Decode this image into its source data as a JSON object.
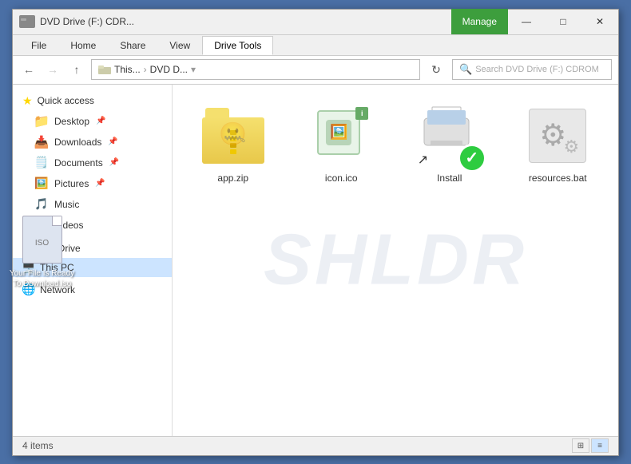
{
  "window": {
    "title": "DVD Drive (F:) CDR...",
    "manage_label": "Manage"
  },
  "title_bar": {
    "icon_label": "📁",
    "title": "DVD Drive (F:) CDR...",
    "min": "—",
    "max": "□",
    "close": "✕"
  },
  "ribbon": {
    "tabs": [
      "File",
      "Home",
      "Share",
      "View",
      "Drive Tools"
    ],
    "active_tab": "Drive Tools"
  },
  "address_bar": {
    "back": "←",
    "forward": "→",
    "up": "↑",
    "breadcrumb_1": "This...",
    "breadcrumb_2": "DVD D...",
    "refresh": "↻",
    "search_placeholder": "Search DVD Drive (F:) CDROM"
  },
  "sidebar": {
    "quick_access": {
      "label": "Quick access",
      "items": [
        {
          "label": "Desktop",
          "pinned": true
        },
        {
          "label": "Downloads",
          "pinned": true
        },
        {
          "label": "Documents",
          "pinned": true
        },
        {
          "label": "Pictures",
          "pinned": true
        },
        {
          "label": "Music",
          "pinned": false
        },
        {
          "label": "Videos",
          "pinned": false
        }
      ]
    },
    "onedrive": {
      "label": "OneDrive"
    },
    "this_pc": {
      "label": "This PC"
    },
    "network": {
      "label": "Network"
    }
  },
  "content": {
    "watermark": "SHLDR",
    "files": [
      {
        "name": "app.zip",
        "type": "zip"
      },
      {
        "name": "icon.ico",
        "type": "ico"
      },
      {
        "name": "Install",
        "type": "installer"
      },
      {
        "name": "resources.bat",
        "type": "bat"
      }
    ]
  },
  "status_bar": {
    "item_count": "4 items",
    "view1": "⊞",
    "view2": "≡"
  },
  "left_file": {
    "name": "Your File Is Ready To Download.iso"
  }
}
